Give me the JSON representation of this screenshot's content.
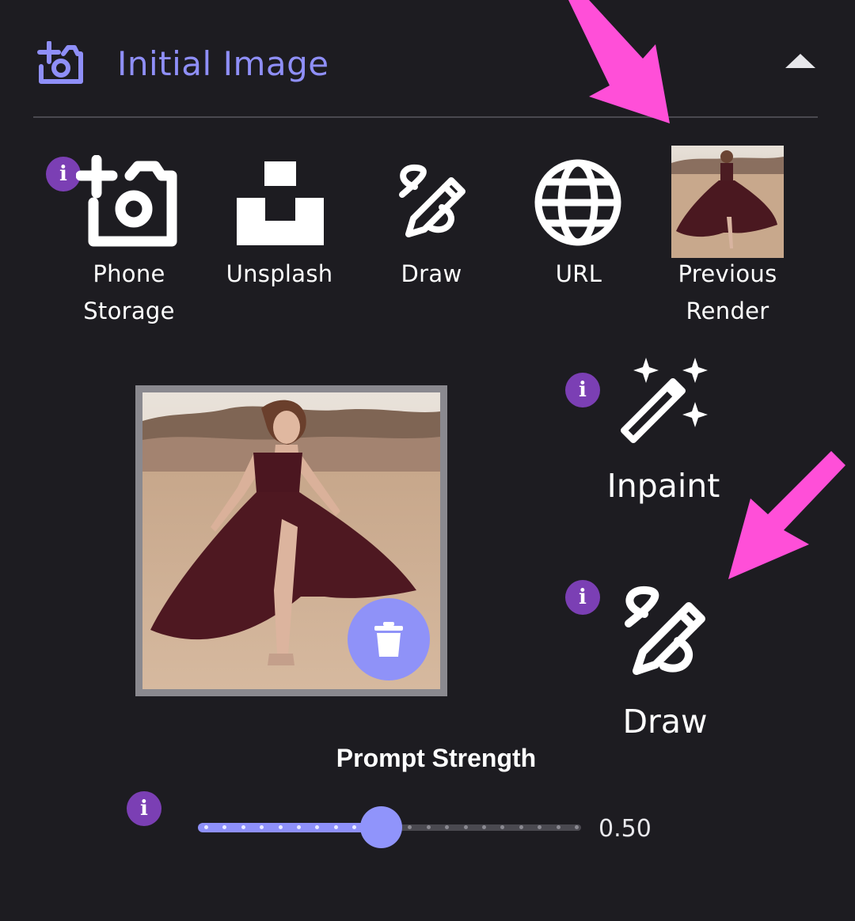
{
  "section": {
    "title": "Initial Image",
    "icon": "add-photo-icon",
    "collapse_icon": "chevron-up-icon"
  },
  "sources": [
    {
      "label_line1": "Phone",
      "label_line2": "Storage",
      "icon": "add-photo-icon"
    },
    {
      "label_line1": "Unsplash",
      "label_line2": "",
      "icon": "unsplash-icon"
    },
    {
      "label_line1": "Draw",
      "label_line2": "",
      "icon": "draw-icon"
    },
    {
      "label_line1": "URL",
      "label_line2": "",
      "icon": "globe-icon"
    },
    {
      "label_line1": "Previous",
      "label_line2": "Render",
      "icon": "previous-render-thumbnail"
    }
  ],
  "actions": {
    "inpaint_label": "Inpaint",
    "draw_label": "Draw"
  },
  "prompt_strength": {
    "title": "Prompt Strength",
    "value": 0.5,
    "value_text": "0.50",
    "min": 0,
    "max": 1
  },
  "colors": {
    "accent": "#8f8ff8",
    "info": "#7b3fb4",
    "annotation_arrow": "#ff4fd8",
    "background": "#1d1c21"
  }
}
